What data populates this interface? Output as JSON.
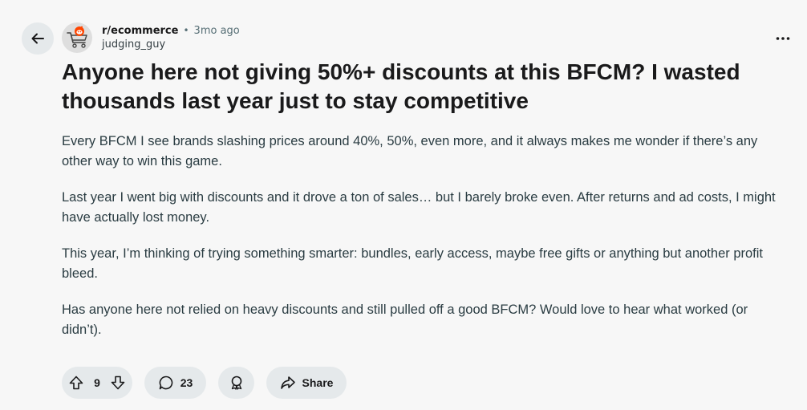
{
  "post": {
    "subreddit": "r/ecommerce",
    "separator": "•",
    "time": "3mo ago",
    "username": "judging_guy",
    "title": "Anyone here not giving 50%+ discounts at this BFCM? I wasted thousands last year just to stay competitive",
    "paragraphs": [
      "Every BFCM I see brands slashing prices around 40%, 50%, even more, and it always makes me wonder if there’s any other way to win this game.",
      "Last year I went big with discounts and it drove a ton of sales… but I barely broke even. After returns and ad costs, I might have actually lost money.",
      "This year, I’m thinking of trying something smarter: bundles, early access, maybe free gifts or anything but another profit bleed.",
      "Has anyone here not relied on heavy discounts and still pulled off a good BFCM? Would love to hear what worked (or didn’t)."
    ]
  },
  "actions": {
    "votes": "9",
    "comments": "23",
    "share_label": "Share"
  },
  "icons": {
    "back": "arrow-left-icon",
    "more": "ellipsis-icon",
    "upvote": "upvote-arrow-icon",
    "downvote": "downvote-arrow-icon",
    "comment": "comment-bubble-icon",
    "award": "award-icon",
    "share": "share-arrow-icon"
  },
  "colors": {
    "background": "#f7f7f7",
    "pill": "#e5e9eb",
    "avatar_accent": "#ff4500"
  }
}
